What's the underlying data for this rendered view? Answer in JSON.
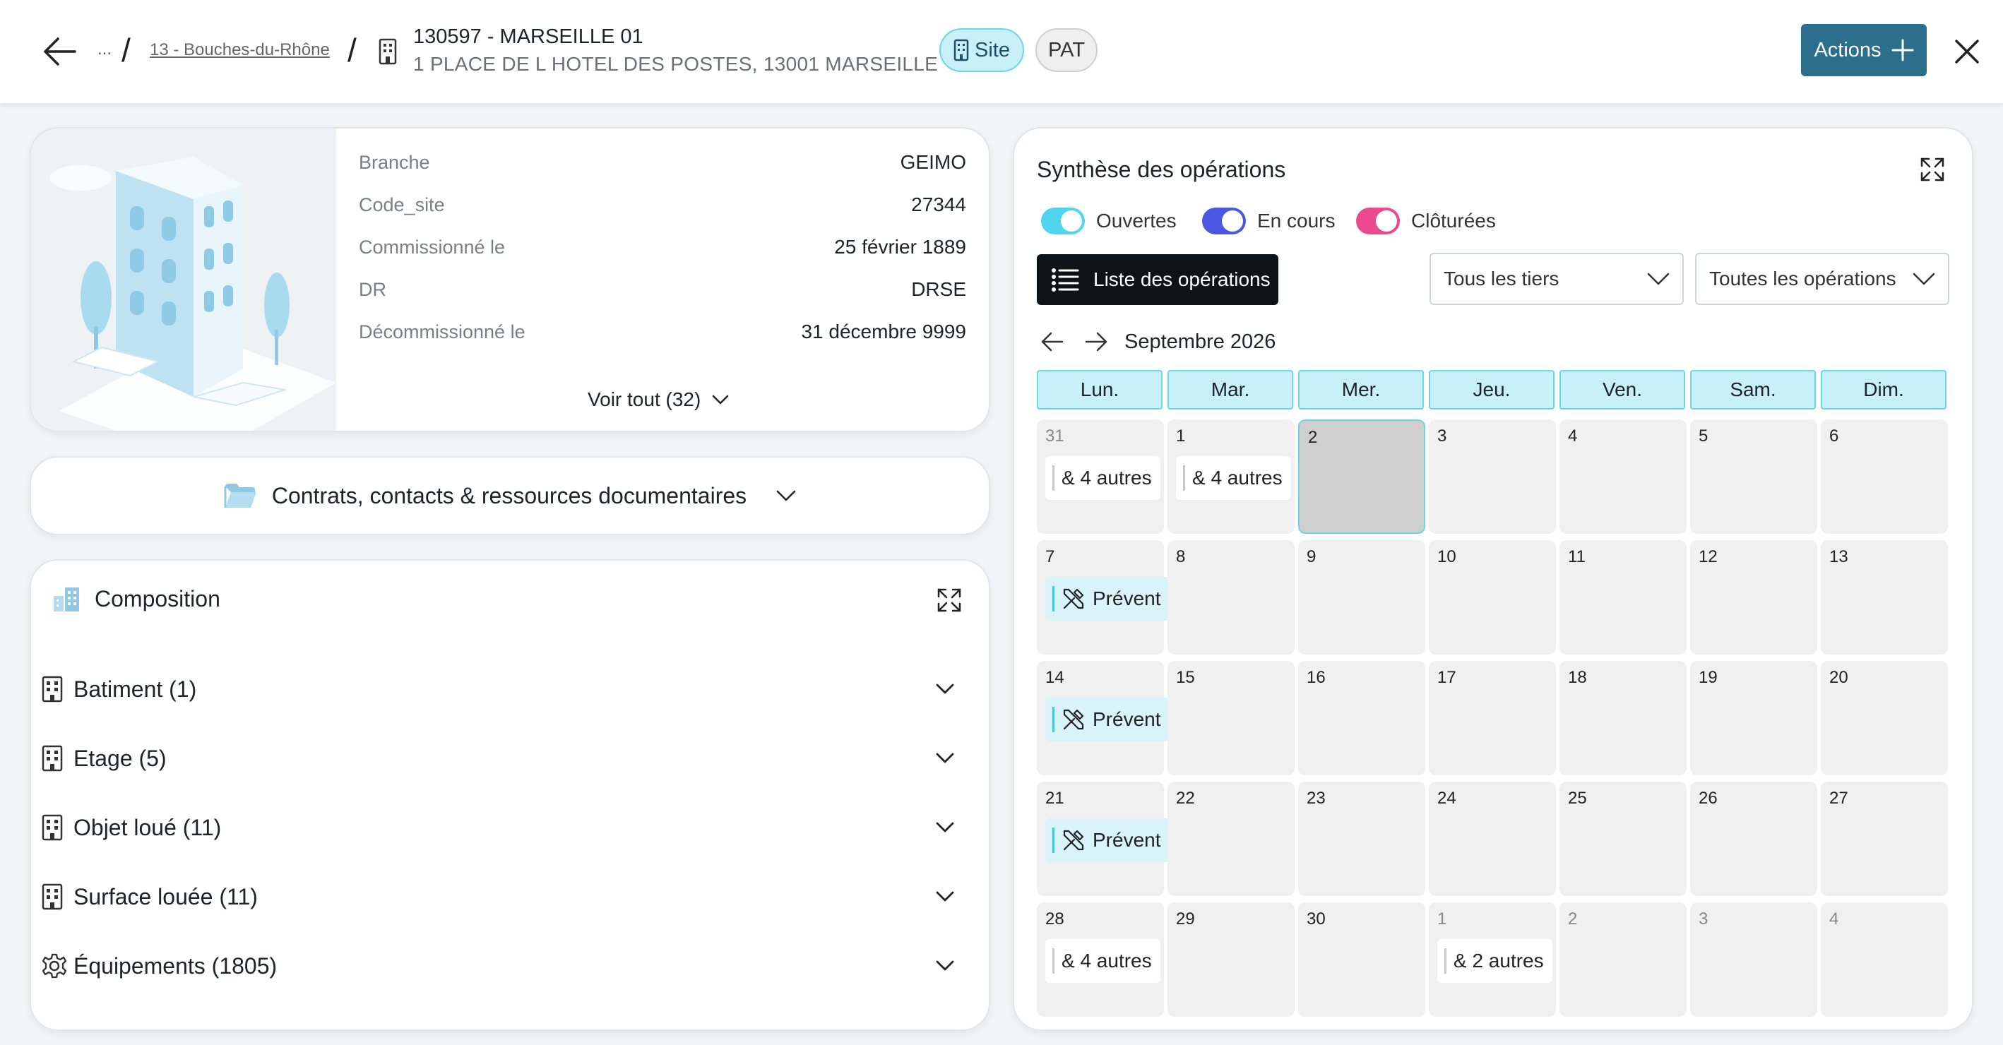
{
  "header": {
    "back_icon": "arrow-left-icon",
    "breadcrumb_ellipsis": "...",
    "breadcrumb_department": "13 - Bouches-du-Rhône",
    "site_title": "130597 - MARSEILLE 01",
    "site_address": "1 PLACE DE L HOTEL DES POSTES, 13001 MARSEILLE",
    "chip_site_label": "Site",
    "chip_pat_label": "PAT",
    "actions_label": "Actions",
    "close_icon": "close-icon"
  },
  "site_info": {
    "rows": [
      {
        "label": "Branche",
        "value": "GEIMO"
      },
      {
        "label": "Code_site",
        "value": "27344"
      },
      {
        "label": "Commissionné le",
        "value": "25 février 1889"
      },
      {
        "label": "DR",
        "value": "DRSE"
      },
      {
        "label": "Décommissionné le",
        "value": "31 décembre 9999"
      }
    ],
    "see_all_label": "Voir tout (32)"
  },
  "documents": {
    "label": "Contrats, contacts & ressources documentaires",
    "icon": "folder-open-icon"
  },
  "composition": {
    "title": "Composition",
    "items": [
      {
        "label": "Batiment (1)",
        "icon": "building-icon"
      },
      {
        "label": "Etage (5)",
        "icon": "building-icon"
      },
      {
        "label": "Objet loué (11)",
        "icon": "building-icon"
      },
      {
        "label": "Surface louée (11)",
        "icon": "building-icon"
      },
      {
        "label": "Équipements (1805)",
        "icon": "gear-icon"
      }
    ]
  },
  "operations": {
    "title": "Synthèse des opérations",
    "toggles": [
      {
        "label": "Ouvertes",
        "color": "#4fd6ee"
      },
      {
        "label": "En cours",
        "color": "#4a57e0"
      },
      {
        "label": "Clôturées",
        "color": "#ec4a8e"
      }
    ],
    "list_button_label": "Liste des opérations",
    "filter_tiers": "Tous les tiers",
    "filter_operations": "Toutes les opérations",
    "month_label": "Septembre 2026",
    "weekdays": [
      "Lun.",
      "Mar.",
      "Mer.",
      "Jeu.",
      "Ven.",
      "Sam.",
      "Dim."
    ],
    "weeks": [
      [
        {
          "n": "31",
          "other": true,
          "event": "& 4 autres",
          "type": "more"
        },
        {
          "n": "1",
          "event": "& 4 autres",
          "type": "more"
        },
        {
          "n": "2",
          "today": true
        },
        {
          "n": "3"
        },
        {
          "n": "4"
        },
        {
          "n": "5"
        },
        {
          "n": "6"
        }
      ],
      [
        {
          "n": "7",
          "event": "Prévent",
          "type": "prevent"
        },
        {
          "n": "8"
        },
        {
          "n": "9"
        },
        {
          "n": "10"
        },
        {
          "n": "11"
        },
        {
          "n": "12"
        },
        {
          "n": "13"
        }
      ],
      [
        {
          "n": "14",
          "event": "Prévent",
          "type": "prevent"
        },
        {
          "n": "15"
        },
        {
          "n": "16"
        },
        {
          "n": "17"
        },
        {
          "n": "18"
        },
        {
          "n": "19"
        },
        {
          "n": "20"
        }
      ],
      [
        {
          "n": "21",
          "event": "Prévent",
          "type": "prevent"
        },
        {
          "n": "22"
        },
        {
          "n": "23"
        },
        {
          "n": "24"
        },
        {
          "n": "25"
        },
        {
          "n": "26"
        },
        {
          "n": "27"
        }
      ],
      [
        {
          "n": "28",
          "event": "& 4 autres",
          "type": "more"
        },
        {
          "n": "29"
        },
        {
          "n": "30"
        },
        {
          "n": "1",
          "other": true,
          "event": "& 2 autres",
          "type": "more"
        },
        {
          "n": "2",
          "other": true
        },
        {
          "n": "3",
          "other": true
        },
        {
          "n": "4",
          "other": true
        }
      ]
    ]
  }
}
